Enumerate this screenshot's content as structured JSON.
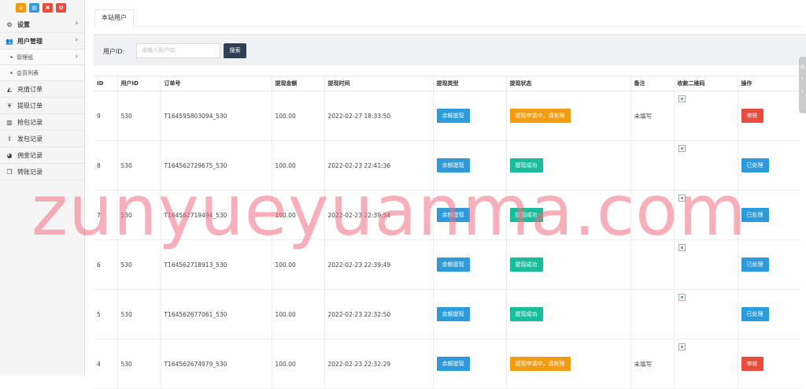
{
  "sidebar": {
    "top_icons": [
      {
        "name": "home-icon",
        "glyph": "⌂",
        "color": "#f39c12"
      },
      {
        "name": "document-icon",
        "glyph": "▤",
        "color": "#3498db"
      },
      {
        "name": "trash-icon",
        "glyph": "✖",
        "color": "#e74c3c"
      },
      {
        "name": "settings-icon",
        "glyph": "✿",
        "color": "#e74c3c"
      }
    ],
    "settings": "设置",
    "user_mgmt": "用户管理",
    "admin_group": "管理组",
    "member_list": "会员列表",
    "recharge_orders": "充值订单",
    "withdraw_orders": "提现订单",
    "grab_records": "抢包记录",
    "send_records": "发包记录",
    "commission_records": "佣金记录",
    "transfer_records": "转账记录"
  },
  "tab": {
    "label": "本站用户"
  },
  "search": {
    "label": "用户ID:",
    "placeholder": "请输入用户ID",
    "button": "搜索"
  },
  "table": {
    "headers": [
      "ID",
      "用户ID",
      "订单号",
      "提现金额",
      "提现时间",
      "提现类型",
      "提现状态",
      "备注",
      "收款二维码",
      "操作"
    ],
    "rows": [
      {
        "id": "9",
        "uid": "530",
        "order": "T164595803094_530",
        "amount": "100.00",
        "time": "2022-02-27 18:33:50",
        "type": "余额提现",
        "status": "提现申请中，请处理",
        "status_color": "orange",
        "note": "未填写",
        "action": "审核",
        "action_color": "red"
      },
      {
        "id": "8",
        "uid": "530",
        "order": "T164562729675_530",
        "amount": "100.00",
        "time": "2022-02-23 22:41:36",
        "type": "余额提现",
        "status": "提现成功",
        "status_color": "green",
        "note": "",
        "action": "已处理",
        "action_color": "blue"
      },
      {
        "id": "7",
        "uid": "530",
        "order": "T164562719494_530",
        "amount": "100.00",
        "time": "2022-02-23 22:39:54",
        "type": "余额提现",
        "status": "提现成功",
        "status_color": "green",
        "note": "",
        "action": "已处理",
        "action_color": "blue"
      },
      {
        "id": "6",
        "uid": "530",
        "order": "T164562718913_530",
        "amount": "100.00",
        "time": "2022-02-23 22:39:49",
        "type": "余额提现",
        "status": "提现成功",
        "status_color": "green",
        "note": "",
        "action": "已处理",
        "action_color": "blue"
      },
      {
        "id": "5",
        "uid": "530",
        "order": "T164562677061_530",
        "amount": "100.00",
        "time": "2022-02-23 22:32:50",
        "type": "余额提现",
        "status": "提现成功",
        "status_color": "green",
        "note": "",
        "action": "已处理",
        "action_color": "blue"
      },
      {
        "id": "4",
        "uid": "530",
        "order": "T164562674979_530",
        "amount": "100.00",
        "time": "2022-02-23 22:32:29",
        "type": "余额提现",
        "status": "提现申请中，请处理",
        "status_color": "orange",
        "note": "未填写",
        "action": "审核",
        "action_color": "red"
      }
    ]
  },
  "watermark": "zunyueyuanma.com",
  "side_widget": {
    "glyph_top": "返",
    "glyph_mid": "↑",
    "glyph_bot": "↓"
  }
}
